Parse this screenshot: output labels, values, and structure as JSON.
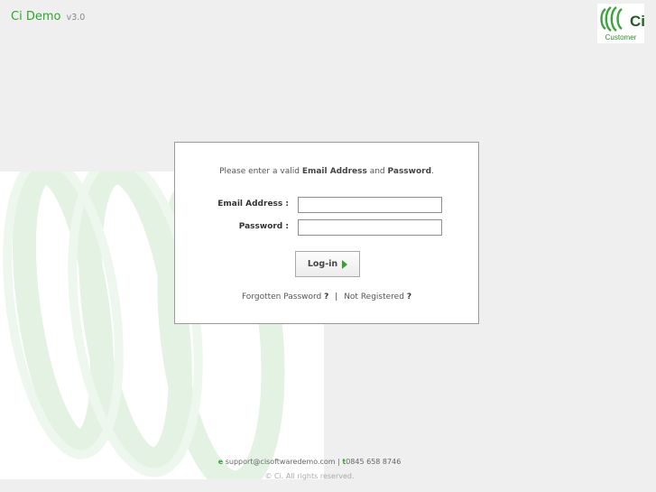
{
  "header": {
    "title": "Ci Demo",
    "version": "v3.0"
  },
  "brand": {
    "logo_text": "Ci",
    "caption": "Customer",
    "icon": "ci-swirl-logo"
  },
  "login": {
    "intro_prefix": "Please enter a valid",
    "intro_email": "Email Address",
    "intro_and": "and",
    "intro_password": "Password",
    "intro_suffix": ".",
    "email_label": "Email Address :",
    "email_value": "",
    "password_label": "Password :",
    "password_value": "",
    "login_label": "Log-in",
    "forgot_label": "Forgotten Password",
    "forgot_mark": "?",
    "separator": "|",
    "register_label": "Not Registered",
    "register_mark": "?"
  },
  "footer": {
    "email_key": "e",
    "email": "support@cisoftwaredemo.com",
    "pipe": "|",
    "phone_key": "t",
    "phone": "0845 658 8746",
    "copyright": "© Ci. All rights reserved."
  },
  "colors": {
    "accent": "#2fa52f",
    "background": "#efefef",
    "panel_border": "#9a9a9a"
  }
}
